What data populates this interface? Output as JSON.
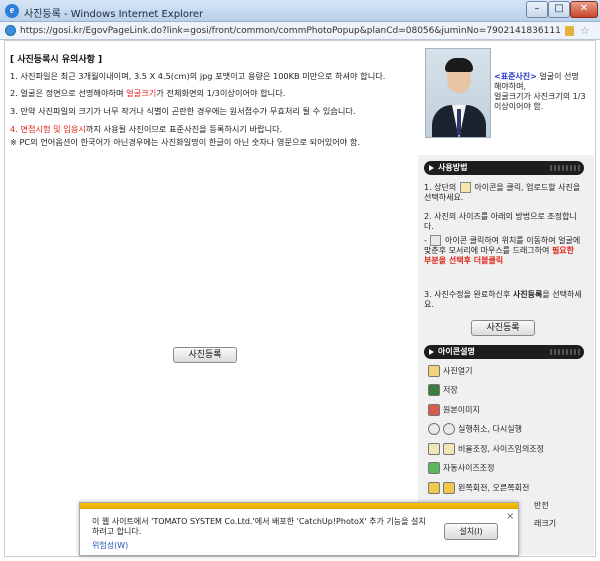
{
  "window": {
    "title": "사진등록 - Windows Internet Explorer",
    "url": "https://gosi.kr/EgovPageLink.do?link=gosi/front/common/commPhotoPopup&planCd=08056&juminNo=7902141836111"
  },
  "notice": {
    "heading": "[ 사진등록시 유의사항 ]",
    "line1": "1. 사진파일은 최근 3개월이내이며, 3.5 X 4.5(cm)의 jpg 포맷이고 용량은 100KB 미만으로 하셔야 합니다.",
    "line2_pre": "2. 얼굴은 정면으로 선명해야하며 ",
    "line2_red": "얼굴크기",
    "line2_post": "가 전체화면의 1/3이상이어야 합니다.",
    "line3": "3. 만약 사진파일의 크기가 너무 작거나 식별이 곤란한 경우에는 원서접수가 무효처리 될 수 있습니다.",
    "line4_num": "4. ",
    "line4_red": "면접시험 및 임용시",
    "line4_post": "까지 사용될 사진이므로 표준사진을 등록하시기 바랍니다.",
    "line5": "※ PC의 언어옵션이 한국어가 아닌경우에는 사진화일명이 한글이 아닌 숫자나 영문으로 되어있어야 함."
  },
  "main_upload_label": "사진등록",
  "standard_photo": {
    "label": "<표준사진>",
    "desc1": " 얼굴이 선명해야하며,",
    "desc2": "얼굴크기가 사진크기의 1/3이상이어야 함."
  },
  "usage": {
    "title": "사용방법",
    "step1_pre": "1. 상단의 ",
    "step1_post": " 아이콘을 클릭, 업로드할 사진을 선택하세요.",
    "step2": "2. 사진의 사이즈를 아래의 방법으로 조정합니다.",
    "step2a_pre": "- ",
    "step2a_post": " 아이콘 클릭하여 위치를 이동하여 얼굴에 맞춘후 모서리에 마우스를 드래그하여 ",
    "step2a_red": "필요한 부분을 선택후 더블클릭",
    "step3_pre": "3. 사진수정을 완료하신후 ",
    "step3_bold": "사진등록",
    "step3_post": "을 선택하세요.",
    "upload_label": "사진등록"
  },
  "icon_help": {
    "title": "아이콘설명",
    "items": [
      {
        "label": "사진열기",
        "icon": "folder-open-icon",
        "color": "#f2d27a"
      },
      {
        "label": "저장",
        "icon": "save-icon",
        "color": "#3a7d3a"
      },
      {
        "label": "원본이미지",
        "icon": "original-image-icon",
        "color": "#d95b4b"
      },
      {
        "label": "실행취소, 다시실행",
        "icon": "undo-redo-icon",
        "color": "#eaeaea"
      },
      {
        "label": "비율조정, 사이즈임의조정",
        "icon": "resize-icon",
        "color": "#f2e6b8"
      },
      {
        "label": "자동사이즈조정",
        "icon": "auto-size-icon",
        "color": "#5bb85b"
      },
      {
        "label": "왼쪽회전, 오른쪽회전",
        "icon": "rotate-icon",
        "color": "#f2c94c"
      }
    ],
    "partial1": "반전",
    "partial2": "래크기"
  },
  "infobar": {
    "message": "이 웹 사이트에서 'TOMATO SYSTEM Co.Ltd.'에서 배포한 'CatchUp!PhotoX' 추가 기능을 설치하려고 합니다.",
    "risk_link": "위험성(W)",
    "install_label": "설치(I)",
    "close_symbol": "×"
  }
}
